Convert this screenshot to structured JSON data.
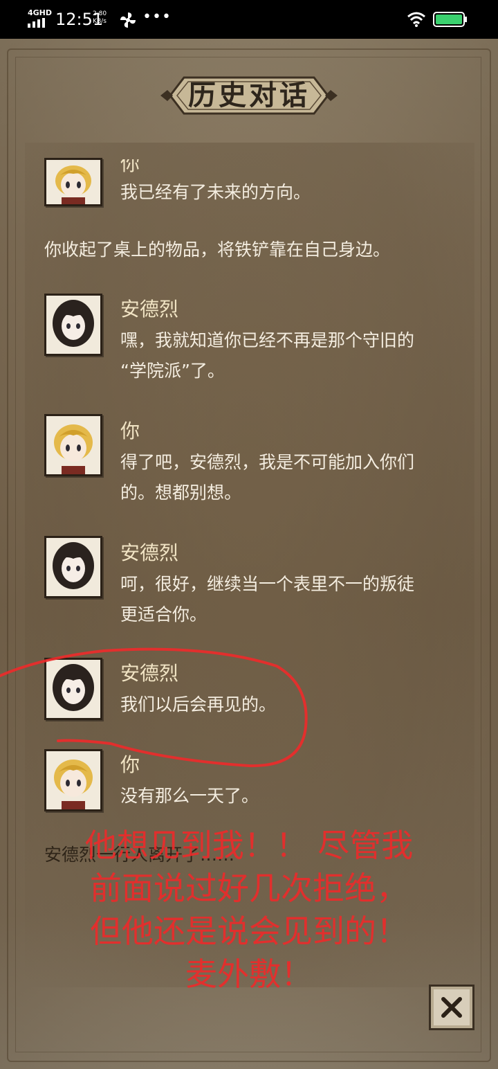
{
  "status_bar": {
    "network": "4GHD",
    "time": "12:51",
    "speed_value": "2.80",
    "speed_unit": "KB/s",
    "more": "•••",
    "battery_level": 0.9
  },
  "panel": {
    "title": "历史对话"
  },
  "dialog": [
    {
      "type": "speech",
      "speaker": "你",
      "avatar": "blonde-boy-avatar",
      "lines": [
        "我已经有了未来的方向。"
      ]
    },
    {
      "type": "narration",
      "text": "你收起了桌上的物品，将铁铲靠在自己身边。"
    },
    {
      "type": "speech",
      "speaker": "安德烈",
      "avatar": "dark-hair-avatar",
      "lines": [
        "嘿，我就知道你已经不再是那个守旧的",
        "“学院派”了。"
      ]
    },
    {
      "type": "speech",
      "speaker": "你",
      "avatar": "blonde-boy-avatar",
      "lines": [
        "得了吧，安德烈，我是不可能加入你们",
        "的。想都别想。"
      ]
    },
    {
      "type": "speech",
      "speaker": "安德烈",
      "avatar": "dark-hair-avatar",
      "lines": [
        "呵，很好，继续当一个表里不一的叛徒",
        "更适合你。"
      ]
    },
    {
      "type": "speech",
      "speaker": "安德烈",
      "avatar": "dark-hair-avatar",
      "lines": [
        "我们以后会再见的。"
      ]
    },
    {
      "type": "speech",
      "speaker": "你",
      "avatar": "blonde-boy-avatar",
      "lines": [
        "没有那么一天了。"
      ]
    },
    {
      "type": "narration",
      "text": "安德烈一行人离开了……"
    }
  ],
  "annotation": {
    "color": "#ee2a2a",
    "lines": [
      "他想见到我！！ 尽管我",
      "前面说过好几次拒绝，",
      "但他还是说会见到的！",
      "麦外敷！"
    ]
  },
  "close_button": {
    "icon": "close-icon"
  },
  "colors": {
    "parchment": "#8d7c63",
    "speaker_text": "#f1e4c4",
    "body_text": "#f4ede0",
    "frame": "#2b2117"
  }
}
